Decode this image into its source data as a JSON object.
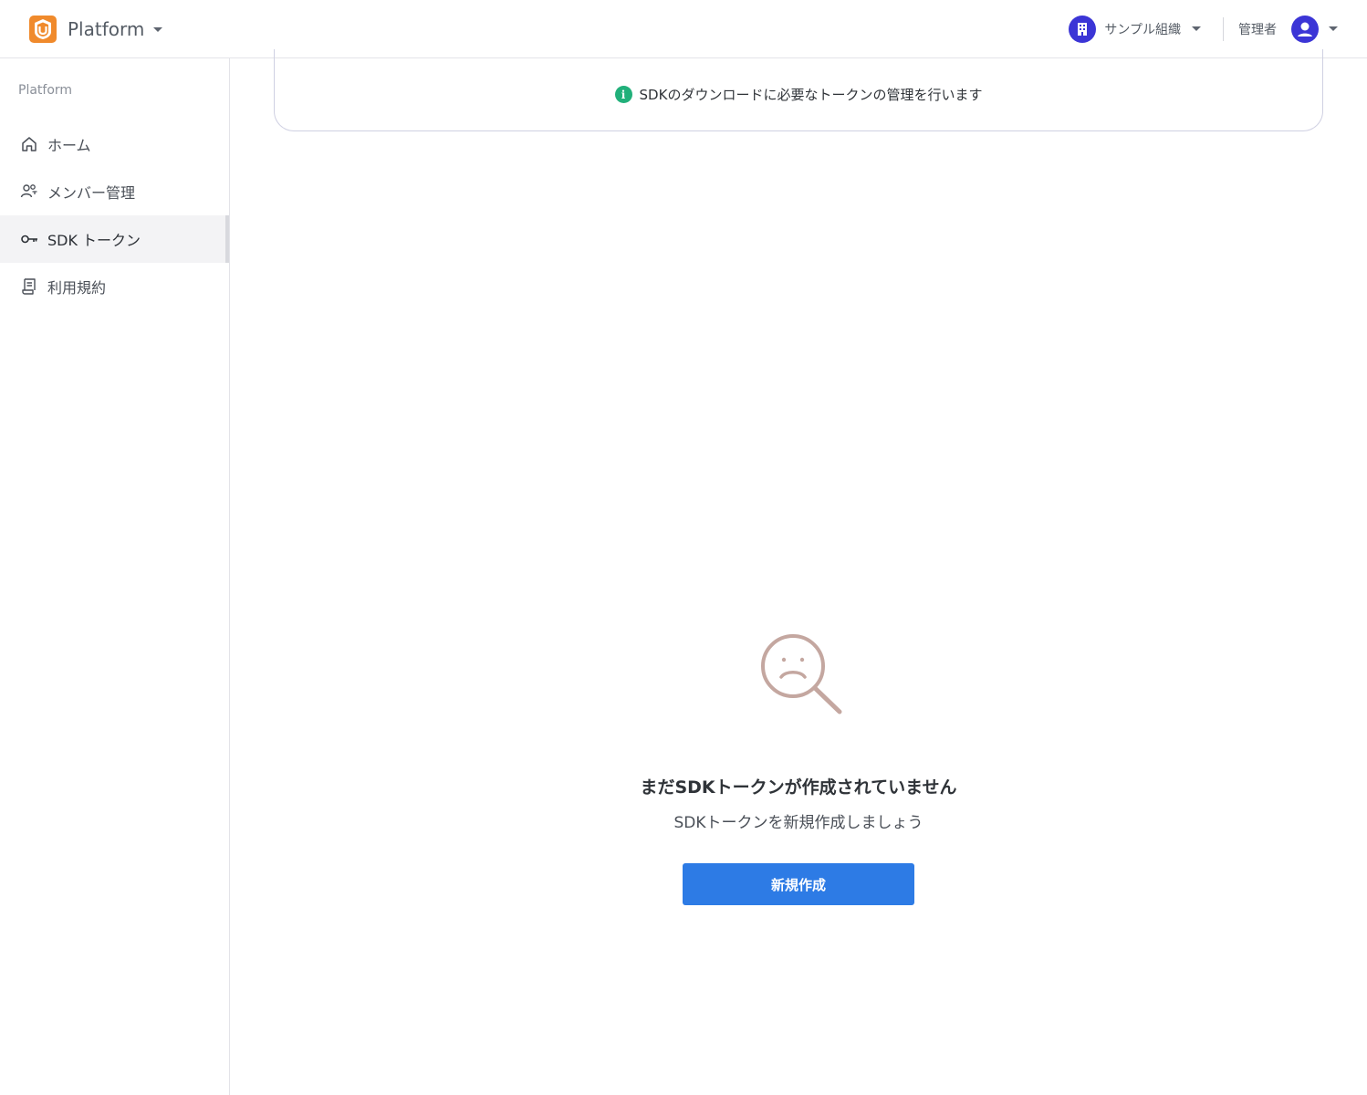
{
  "header": {
    "app_name": "Platform",
    "org_name": "サンプル組織",
    "user_role": "管理者",
    "icons": {
      "logo": "platform-logo",
      "app_switch": "caret-down-icon",
      "org": "building-icon",
      "user": "user-avatar-icon"
    },
    "colors": {
      "logo": "#f08a2c",
      "org": "#3b35d6",
      "avatar": "#3b35d6"
    }
  },
  "sidebar": {
    "section_title": "Platform",
    "items": [
      {
        "label": "ホーム",
        "icon": "home-icon",
        "active": false
      },
      {
        "label": "メンバー管理",
        "icon": "members-icon",
        "active": false
      },
      {
        "label": "SDK トークン",
        "icon": "key-icon",
        "active": true
      },
      {
        "label": "利用規約",
        "icon": "document-icon",
        "active": false
      }
    ]
  },
  "main": {
    "info": {
      "text": "SDKのダウンロードに必要なトークンの管理を行います",
      "icon": "info-icon",
      "icon_color": "#21b07a"
    },
    "empty_state": {
      "illustration": "sad-magnifier-icon",
      "title": "まだSDKトークンが作成されていません",
      "subtitle": "SDKトークンを新規作成しましょう",
      "button_label": "新規作成",
      "button_color": "#2d7be5"
    }
  }
}
